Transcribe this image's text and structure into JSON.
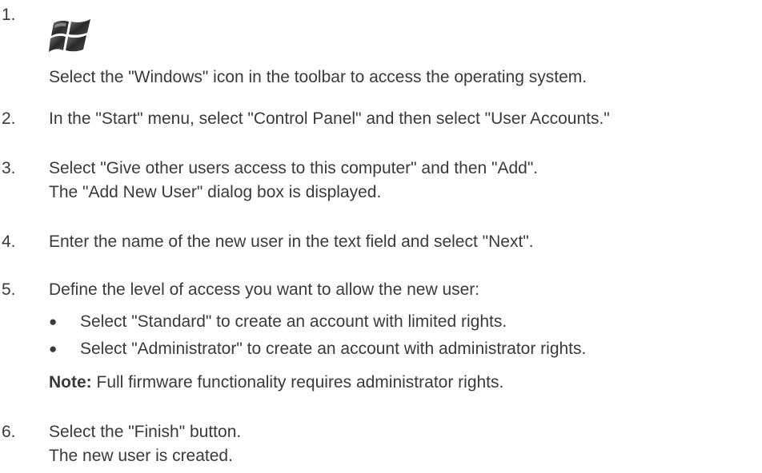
{
  "steps": [
    {
      "number": "1.",
      "icon": "windows-logo-icon",
      "text": "Select the \"Windows\" icon in the toolbar to access the operating system."
    },
    {
      "number": "2.",
      "text": "In the \"Start\" menu, select \"Control Panel\" and then select \"User Accounts.\""
    },
    {
      "number": "3.",
      "lines": [
        "Select \"Give other users access to this computer\" and then \"Add\".",
        "The \"Add New User\" dialog box is displayed."
      ]
    },
    {
      "number": "4.",
      "text": "Enter the name of the new user in the text field and select \"Next\"."
    },
    {
      "number": "5.",
      "text": "Define the level of access you want to allow the new user:",
      "bullets": [
        "Select \"Standard\" to create an account with limited rights.",
        "Select \"Administrator\" to create an account with administrator rights."
      ],
      "note_label": "Note:",
      "note_text": " Full firmware functionality requires administrator rights."
    },
    {
      "number": "6.",
      "lines": [
        "Select the \"Finish\" button.",
        "The new user is created."
      ]
    }
  ],
  "bullet_symbol": "●",
  "colors": {
    "text": "#3a3a3a"
  }
}
